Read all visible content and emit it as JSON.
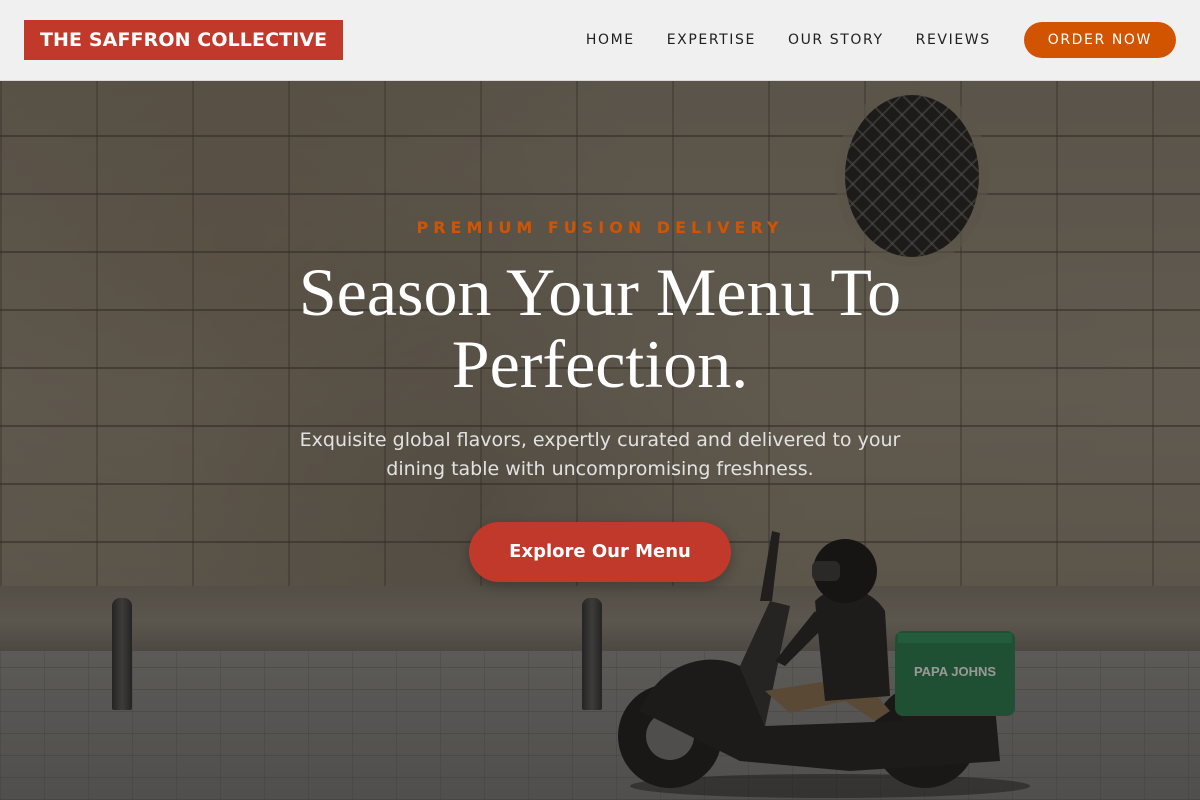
{
  "brand": {
    "name": "THE SAFFRON COLLECTIVE",
    "accent_color": "#c0392b",
    "order_color": "#d35400"
  },
  "nav": {
    "items": [
      {
        "label": "HOME"
      },
      {
        "label": "EXPERTISE"
      },
      {
        "label": "OUR STORY"
      },
      {
        "label": "REVIEWS"
      }
    ],
    "order_label": "ORDER NOW"
  },
  "hero": {
    "eyebrow": "PREMIUM FUSION DELIVERY",
    "headline": "Season Your Menu To Perfection.",
    "subhead": "Exquisite global flavors, expertly curated and delivered to your dining table with uncompromising freshness.",
    "cta_label": "Explore Our Menu",
    "image_description_icon": "delivery-scooter-photo",
    "scooter_box_text": "PAPA JOHNS"
  }
}
